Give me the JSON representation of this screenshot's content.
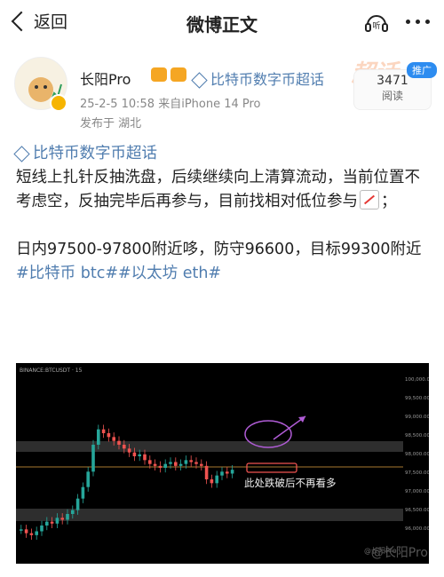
{
  "nav": {
    "back_label": "返回",
    "title": "微博正文"
  },
  "post": {
    "author": "长阳Pro",
    "topic": "比特币数字币超话",
    "time": "25-2-5 10:58",
    "device": "来自iPhone 14 Pro",
    "location": "发布于 湖北",
    "read_count": "3471",
    "read_label": "阅读",
    "rank_label": "推广",
    "watermark_text": "超话",
    "body_topic": "比特币数字币超话",
    "body_line1": "短线上扎针反抽洗盘，后续继续向上清算流动，当前位置不考虑空，反抽完毕后再参与，目前找相对低位参与",
    "body_line1_tail": "；",
    "body_line2": "日内97500-97800附近哆，防守96600，目标99300附近",
    "hashtags": "#比特币 btc##以太坊 eth#"
  },
  "chart_data": {
    "type": "candlestick",
    "annotation": "此处跌破后不再看多",
    "y_axis_ticks": [
      "100,000.00",
      "99,500.00",
      "99,000.00",
      "98,500.00",
      "98,000.00",
      "97,500.00",
      "97,000.00",
      "96,500.00",
      "96,000.00"
    ],
    "symbol_header": "BINANCE:BTCUSDT · 15",
    "watermark": "@长阳Pro",
    "colors": {
      "up": "#26a69a",
      "down": "#ef5350",
      "zone": "#3a3a3a",
      "annotation": "#f0f0f0",
      "ellipse": "#b05cd6",
      "level": "#e0a040"
    }
  },
  "footer": {
    "watermark": "@长阳Pro",
    "watermark2": "@长阳Pro"
  }
}
